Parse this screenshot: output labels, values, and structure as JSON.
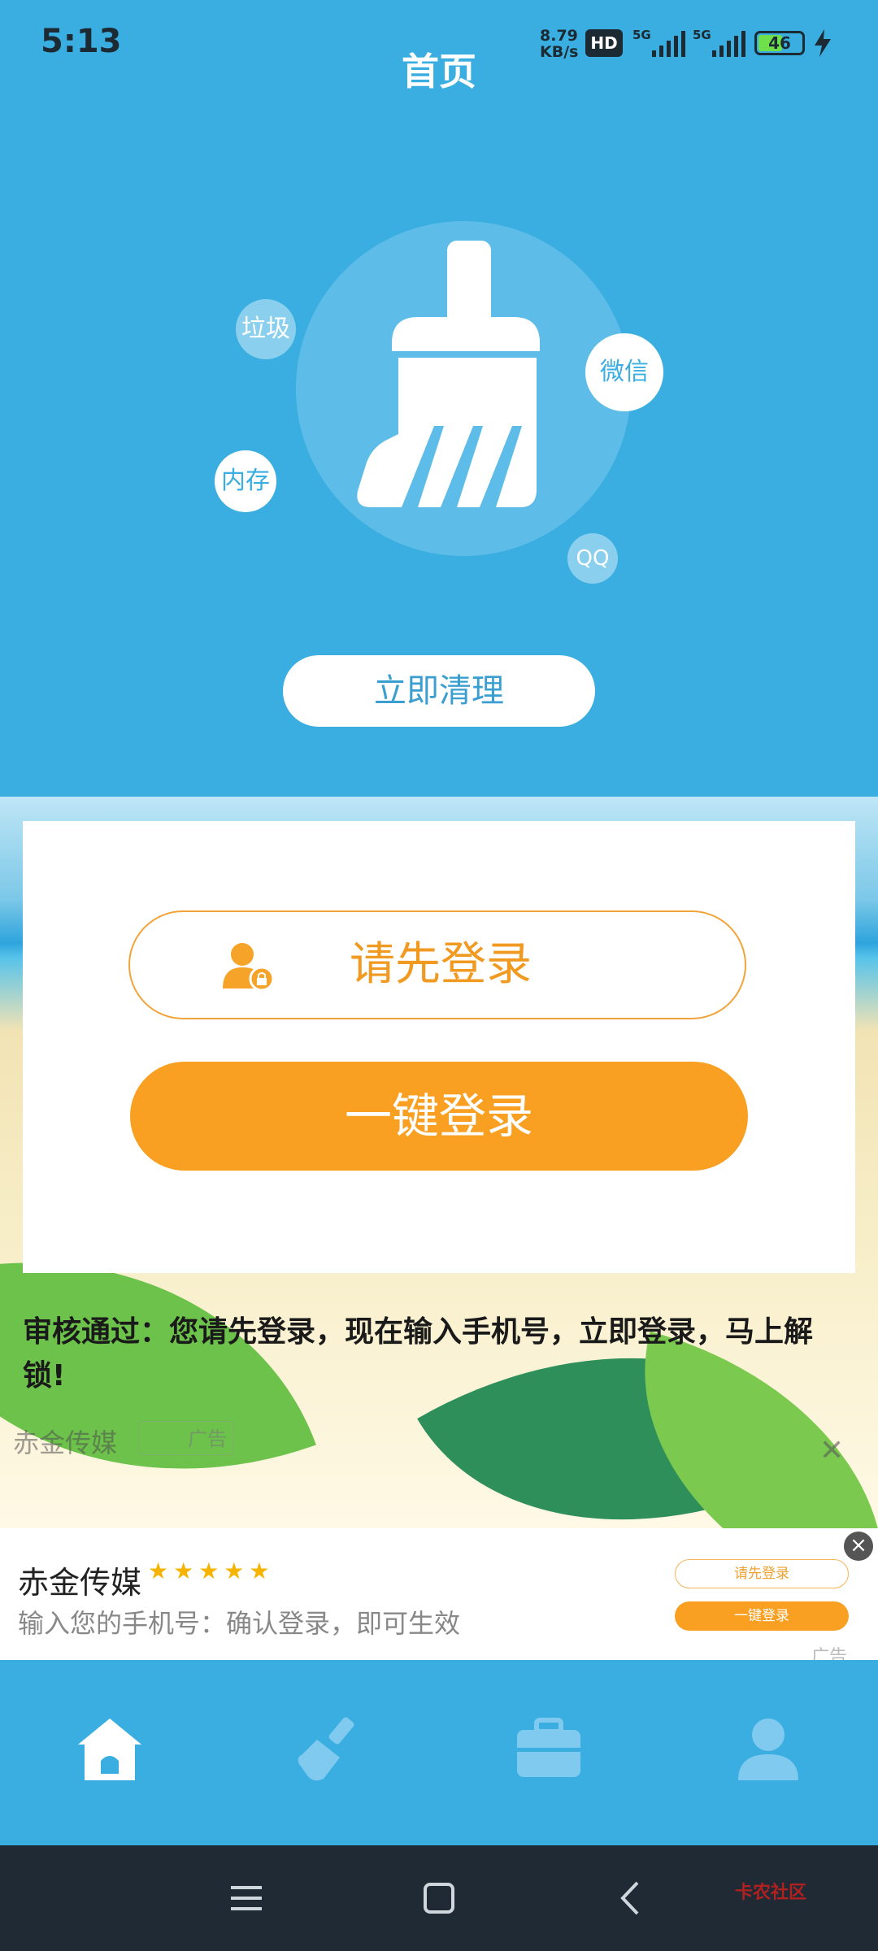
{
  "status_bar": {
    "time": "5:13",
    "net_speed_top": "8.79",
    "net_speed_bottom": "KB/s",
    "hd": "HD",
    "net_type_1": "5G",
    "net_type_2": "5G",
    "battery": "46"
  },
  "header": {
    "title": "首页"
  },
  "cleaner": {
    "bubbles": [
      "垃圾",
      "微信",
      "内存",
      "QQ"
    ],
    "clean_button": "立即清理"
  },
  "ad": {
    "login_hint": "请先登录",
    "login_button": "一键登录",
    "description": "审核通过：您请先登录，现在输入手机号，立即登录，马上解锁!",
    "brand": "赤金传媒",
    "ad_tag": "广告"
  },
  "banner": {
    "brand": "赤金传媒",
    "stars": "★★★★★",
    "description": "输入您的手机号：确认登录，即可生效",
    "mini_hint": "请先登录",
    "mini_button": "一键登录",
    "ad_tag": "广告"
  },
  "tabs": [
    "home-icon",
    "broom-icon",
    "toolbox-icon",
    "user-icon"
  ],
  "watermark": "卡农社区"
}
